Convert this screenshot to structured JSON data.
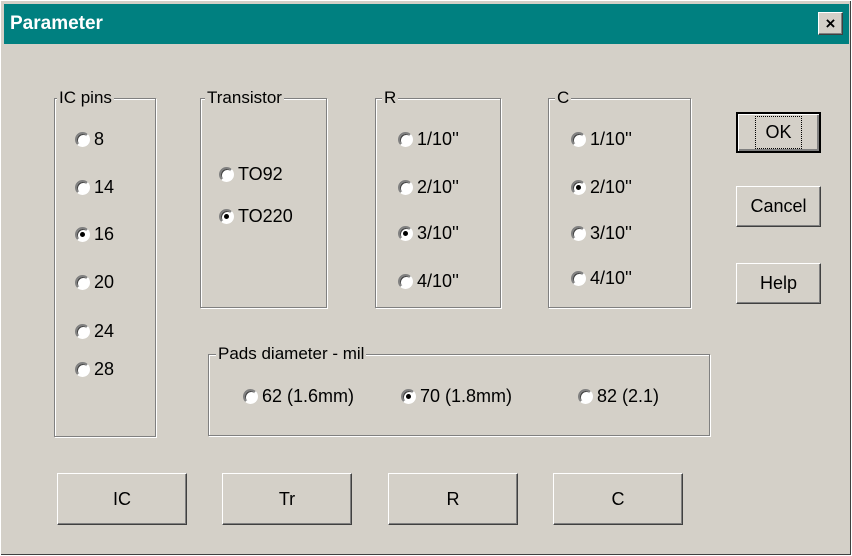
{
  "window": {
    "title": "Parameter",
    "close_glyph": "×"
  },
  "ic_pins": {
    "label": "IC pins",
    "options": [
      "8",
      "14",
      "16",
      "20",
      "24",
      "28"
    ],
    "selected": "16"
  },
  "transistor": {
    "label": "Transistor",
    "options": [
      "TO92",
      "TO220"
    ],
    "selected": "TO220"
  },
  "r": {
    "label": "R",
    "options": [
      "1/10''",
      "2/10''",
      "3/10''",
      "4/10''"
    ],
    "selected": "3/10''"
  },
  "c": {
    "label": "C",
    "options": [
      "1/10''",
      "2/10''",
      "3/10''",
      "4/10''"
    ],
    "selected": "2/10''"
  },
  "pads": {
    "label": "Pads diameter  -  mil",
    "options": [
      "62  (1.6mm)",
      "70  (1.8mm)",
      "82  (2.1)"
    ],
    "selected": "70  (1.8mm)"
  },
  "buttons": {
    "ok": "OK",
    "cancel": "Cancel",
    "help": "Help"
  },
  "bottom_buttons": {
    "ic": "IC",
    "tr": "Tr",
    "r": "R",
    "c": "C"
  }
}
